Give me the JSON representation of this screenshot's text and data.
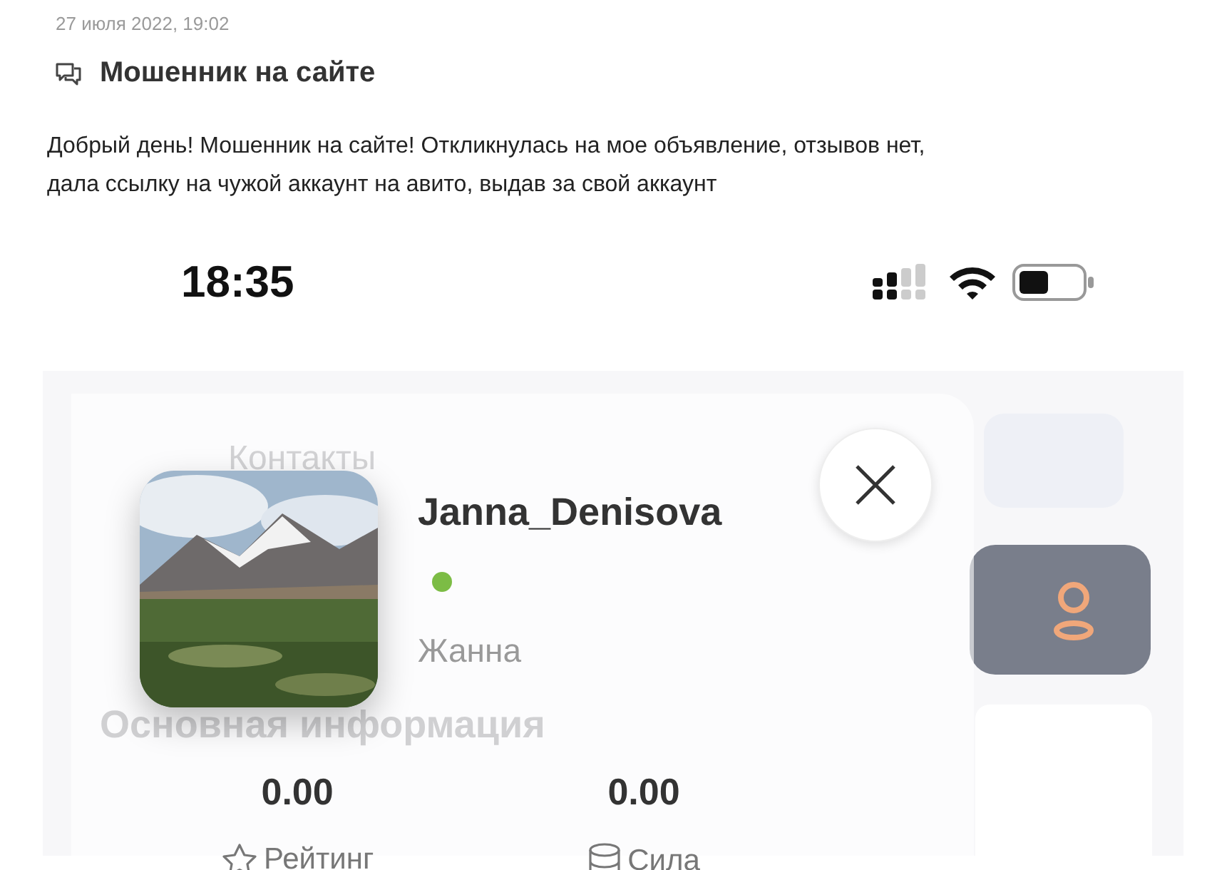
{
  "post": {
    "date": "27 июля 2022, 19:02",
    "title": "Мошенник на сайте",
    "body": "Добрый день! Мошенник на сайте! Откликнулась на мое объявление, отзывов нет, дала ссылку на чужой аккаунт на авито, выдав за свой аккаунт"
  },
  "screenshot": {
    "status_bar": {
      "time": "18:35"
    },
    "background": {
      "section": "Контакты",
      "heading": "Основная информация"
    },
    "profile_card": {
      "username": "Janna_Denisova",
      "online": true,
      "name": "Жанна",
      "stats": [
        {
          "value": "0.00",
          "label": "Рейтинг",
          "kind": "rating"
        },
        {
          "value": "0.00",
          "label": "Сила",
          "kind": "strength"
        }
      ]
    }
  }
}
